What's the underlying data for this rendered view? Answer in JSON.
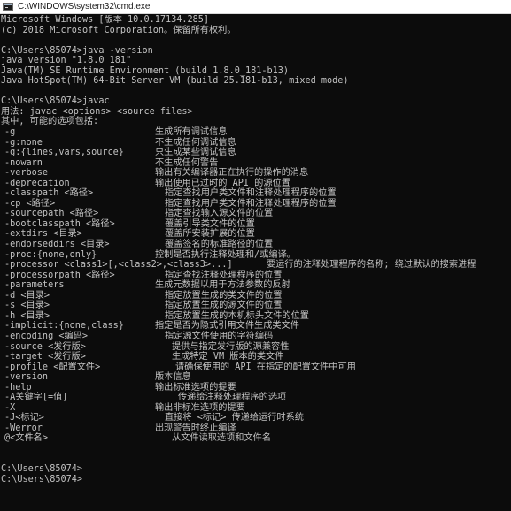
{
  "window": {
    "title": "C:\\WINDOWS\\system32\\cmd.exe",
    "title_icon": "cmd-console-icon",
    "colors": {
      "console_background": "#0c0c0c",
      "console_text": "#c2c2c2",
      "titlebar_background": "#ffffff"
    }
  },
  "console": {
    "lines": [
      "Microsoft Windows [版本 10.0.17134.285]",
      "(c) 2018 Microsoft Corporation。保留所有权利。",
      "",
      "C:\\Users\\85074>java -version",
      "java version \"1.8.0_181\"",
      "Java(TM) SE Runtime Environment (build 1.8.0_181-b13)",
      "Java HotSpot(TM) 64-Bit Server VM (build 25.181-b13, mixed mode)",
      "",
      "C:\\Users\\85074>javac",
      "用法: javac <options> <source files>",
      "其中, 可能的选项包括:"
    ],
    "options": [
      {
        "opt": "-g",
        "desc": "生成所有调试信息"
      },
      {
        "opt": "-g:none",
        "desc": "不生成任何调试信息"
      },
      {
        "opt": "-g:{lines,vars,source}",
        "desc": "只生成某些调试信息"
      },
      {
        "opt": "-nowarn",
        "desc": "不生成任何警告"
      },
      {
        "opt": "-verbose",
        "desc": "输出有关编译器正在执行的操作的消息"
      },
      {
        "opt": "-deprecation",
        "desc": "输出使用已过时的 API 的源位置"
      },
      {
        "opt": "-classpath <路径>",
        "desc": "指定查找用户类文件和注释处理程序的位置"
      },
      {
        "opt": "-cp <路径>",
        "desc": "指定查找用户类文件和注释处理程序的位置"
      },
      {
        "opt": "-sourcepath <路径>",
        "desc": "指定查找输入源文件的位置"
      },
      {
        "opt": "-bootclasspath <路径>",
        "desc": "覆盖引导类文件的位置"
      },
      {
        "opt": "-extdirs <目录>",
        "desc": "覆盖所安装扩展的位置"
      },
      {
        "opt": "-endorseddirs <目录>",
        "desc": "覆盖签名的标准路径的位置"
      },
      {
        "opt": "-proc:{none,only}",
        "desc": "控制是否执行注释处理和/或编译。"
      },
      {
        "opt": "-processor <class1>[,<class2>,<class3>...]",
        "desc": "要运行的注释处理程序的名称; 绕过默认的搜索进程"
      },
      {
        "opt": "-processorpath <路径>",
        "desc": "指定查找注释处理程序的位置"
      },
      {
        "opt": "-parameters",
        "desc": "生成元数据以用于方法参数的反射"
      },
      {
        "opt": "-d <目录>",
        "desc": "指定放置生成的类文件的位置"
      },
      {
        "opt": "-s <目录>",
        "desc": "指定放置生成的源文件的位置"
      },
      {
        "opt": "-h <目录>",
        "desc": "指定放置生成的本机标头文件的位置"
      },
      {
        "opt": "-implicit:{none,class}",
        "desc": "指定是否为隐式引用文件生成类文件"
      },
      {
        "opt": "-encoding <编码>",
        "desc": "指定源文件使用的字符编码"
      },
      {
        "opt": "-source <发行版>",
        "desc": "提供与指定发行版的源兼容性"
      },
      {
        "opt": "-target <发行版>",
        "desc": "生成特定 VM 版本的类文件"
      },
      {
        "opt": "-profile <配置文件>",
        "desc": "请确保使用的 API 在指定的配置文件中可用"
      },
      {
        "opt": "-version",
        "desc": "版本信息"
      },
      {
        "opt": "-help",
        "desc": "输出标准选项的提要"
      },
      {
        "opt": "-A关键字[=值]",
        "desc": "传递给注释处理程序的选项"
      },
      {
        "opt": "-X",
        "desc": "输出非标准选项的提要"
      },
      {
        "opt": "-J<标记>",
        "desc": "直接将 <标记> 传递给运行时系统"
      },
      {
        "opt": "-Werror",
        "desc": "出现警告时终止编译"
      },
      {
        "opt": "@<文件名>",
        "desc": "从文件读取选项和文件名"
      }
    ],
    "tail_lines": [
      "",
      "",
      "C:\\Users\\85074>",
      "C:\\Users\\85074>"
    ]
  }
}
